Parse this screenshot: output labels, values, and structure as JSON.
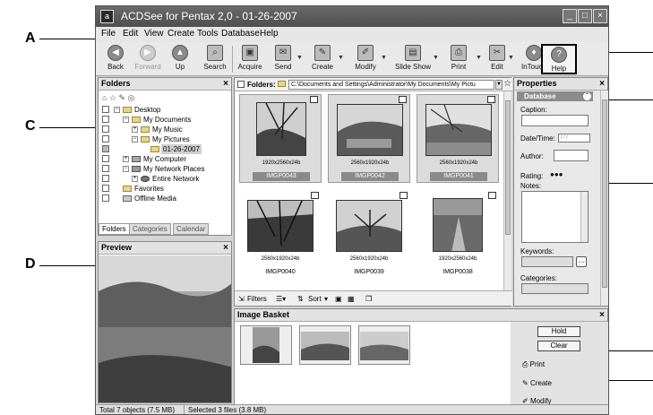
{
  "callouts": {
    "a": "A",
    "c": "C",
    "d": "D"
  },
  "window": {
    "title": "ACDSee for Pentax 2,0 - 01-26-2007",
    "minimize": "_",
    "maximize": "□",
    "close": "×",
    "app_icon": "a"
  },
  "menu": [
    "File",
    "Edit",
    "View",
    "Create",
    "Tools",
    "Database",
    "Help"
  ],
  "toolbar": {
    "back": "Back",
    "forward": "Forward",
    "up": "Up",
    "search": "Search",
    "acquire": "Acquire",
    "send": "Send",
    "create": "Create",
    "modify": "Modify",
    "slideshow": "Slide Show",
    "print": "Print",
    "edit": "Edit",
    "intouch": "InTouch",
    "help": "Help"
  },
  "folders_pane": {
    "title": "Folders",
    "tree": [
      {
        "label": "Desktop"
      },
      {
        "label": "My Documents"
      },
      {
        "label": "My Music"
      },
      {
        "label": "My Pictures"
      },
      {
        "label": "01-26-2007"
      },
      {
        "label": "My Computer"
      },
      {
        "label": "My Network Places"
      },
      {
        "label": "Entire Network"
      },
      {
        "label": "Favorites"
      },
      {
        "label": "Offline Media"
      }
    ],
    "tabs": [
      "Folders",
      "Categories",
      "Calendar"
    ]
  },
  "preview_pane": {
    "title": "Preview"
  },
  "main": {
    "folders_label": "Folders:",
    "path": "C:\\Documents and Settings\\Administrator\\My Documents\\My Pictu",
    "thumbs": [
      {
        "res": "1920x2560x24b",
        "name": "IMGP0043"
      },
      {
        "res": "2560x1920x24b",
        "name": "IMGP0042"
      },
      {
        "res": "2560x1920x24b",
        "name": "IMGP0041"
      },
      {
        "res": "2560x1920x24b",
        "name": "IMGP0040"
      },
      {
        "res": "2560x1920x24b",
        "name": "IMGP0039"
      },
      {
        "res": "1920x2560x24b",
        "name": "IMGP0038"
      }
    ],
    "filters": "Filters",
    "sort": "Sort"
  },
  "properties": {
    "title": "Properties",
    "section": "Database",
    "caption": "Caption:",
    "datetime": "Date/Time:",
    "author": "Author:",
    "rating": "Rating:",
    "notes": "Notes:",
    "keywords": "Keywords:",
    "categories": "Categories:",
    "keywords_btn": "...",
    "datetime_value": "/ ⁄ /"
  },
  "basket": {
    "title": "Image Basket",
    "hold": "Hold",
    "clear": "Clear",
    "print": "Print",
    "create": "Create",
    "modify": "Modify"
  },
  "status": {
    "total": "Total 7 objects  (7.5 MB)",
    "selected": "Selected 3 files (3.8 MB)"
  }
}
